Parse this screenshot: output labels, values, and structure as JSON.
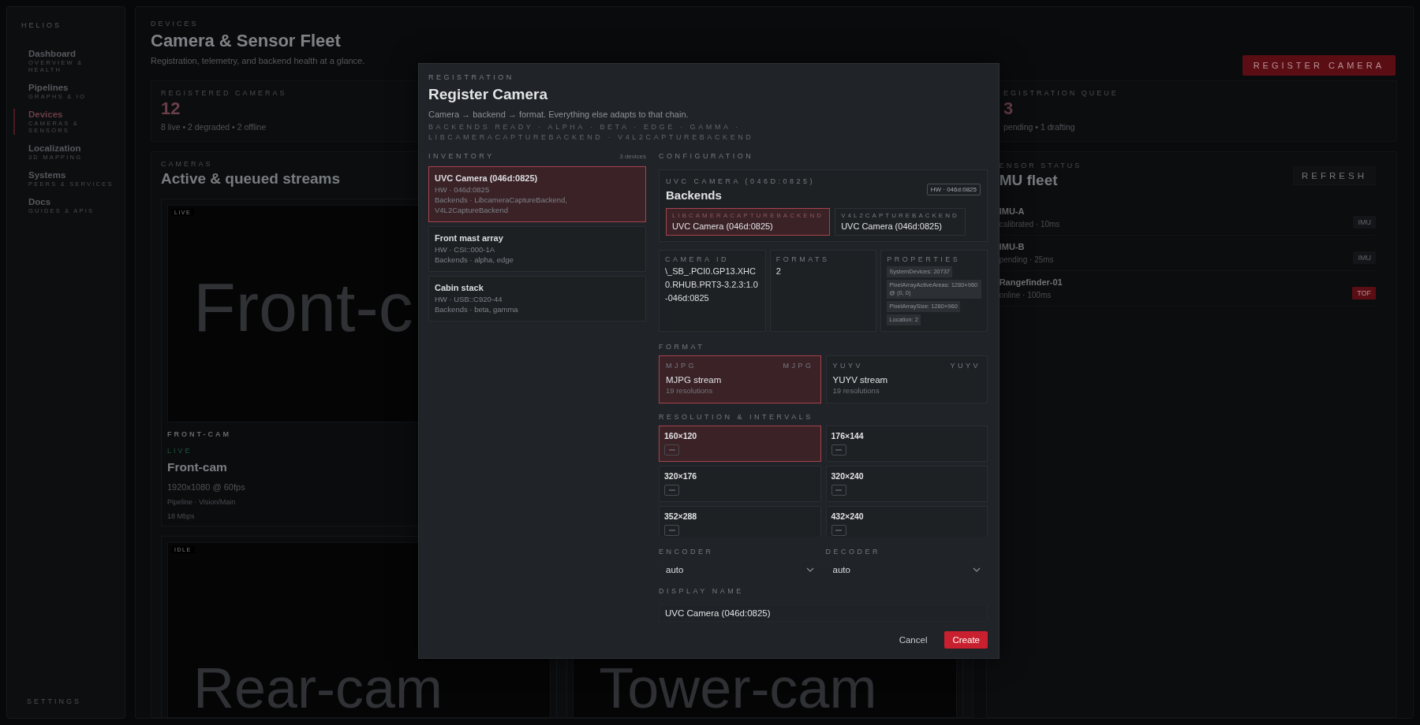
{
  "sidebar": {
    "brand": "HELIOS",
    "items": [
      {
        "label": "Dashboard",
        "sublabel": "OVERVIEW & HEALTH",
        "selected": false
      },
      {
        "label": "Pipelines",
        "sublabel": "GRAPHS & IO",
        "selected": false
      },
      {
        "label": "Devices",
        "sublabel": "CAMERAS & SENSORS",
        "selected": true
      },
      {
        "label": "Localization",
        "sublabel": "3D MAPPING",
        "selected": false
      },
      {
        "label": "Systems",
        "sublabel": "PEERS & SERVICES",
        "selected": false
      },
      {
        "label": "Docs",
        "sublabel": "GUIDES & APIS",
        "selected": false
      }
    ],
    "footer": "SETTINGS"
  },
  "header": {
    "eyebrow": "DEVICES",
    "title": "Camera & Sensor Fleet",
    "subtitle": "Registration, telemetry, and backend health at a glance.",
    "action": "REGISTER CAMERA"
  },
  "stats": [
    {
      "label": "REGISTERED CAMERAS",
      "value": "12",
      "detail": "8 live • 2 degraded • 2 offline"
    },
    {
      "label": "EGISTRATION QUEUE",
      "value": "3",
      "detail": "pending • 1 drafting"
    }
  ],
  "cameras": {
    "eyebrow": "CAMERAS",
    "title": "Active & queued streams",
    "cards": [
      {
        "tag": "LIVE",
        "preview": "Front-c",
        "caps_name": "FRONT-CAM",
        "status": "LIVE",
        "name": "Front-cam",
        "resolution": "1920x1080 @ 60fps",
        "pipeline": "Pipeline · Vision/Main",
        "bitrate": "18 Mbps"
      },
      {
        "tag": "IDLE",
        "preview": "Rear-cam"
      },
      {
        "preview": "Tower-cam"
      }
    ]
  },
  "sensors": {
    "eyebrow": "ENSOR STATUS",
    "title": "MU fleet",
    "action": "REFRESH",
    "items": [
      {
        "name": "IMU-A",
        "detail": "calibrated · 10ms",
        "badge": "IMU",
        "kind": "muted"
      },
      {
        "name": "IMU-B",
        "detail": "pending · 25ms",
        "badge": "IMU",
        "kind": "muted"
      },
      {
        "name": "Rangefinder-01",
        "detail": "online · 100ms",
        "badge": "TOF",
        "kind": "alert"
      }
    ]
  },
  "modal": {
    "eyebrow": "REGISTRATION",
    "title": "Register Camera",
    "description": "Camera → backend → format. Everything else adapts to that chain.",
    "backends_ready": "BACKENDS READY · ALPHA · BETA · EDGE · GAMMA · LIBCAMERACAPTUREBACKEND · V4L2CAPTUREBACKEND",
    "inventory": {
      "label": "INVENTORY",
      "count": "3 devices",
      "items": [
        {
          "name": "UVC Camera (046d:0825)",
          "hw": "HW · 046d:0825",
          "backends": "Backends · LibcameraCaptureBackend, V4L2CaptureBackend",
          "selected": true
        },
        {
          "name": "Front mast array",
          "hw": "HW · CSI::000-1A",
          "backends": "Backends · alpha, edge",
          "selected": false
        },
        {
          "name": "Cabin stack",
          "hw": "HW · USB::C920-44",
          "backends": "Backends · beta, gamma",
          "selected": false
        }
      ]
    },
    "configuration": {
      "label": "CONFIGURATION",
      "camera": {
        "eyebrow": "UVC CAMERA (046D:0825)",
        "title": "Backends",
        "hw_badge": "HW · 046d:0825",
        "backends": [
          {
            "name": "LIBCAMERACAPTUREBACKEND",
            "camera": "UVC Camera (046d:0825)",
            "selected": true
          },
          {
            "name": "V4L2CAPTUREBACKEND",
            "camera": "UVC Camera (046d:0825)",
            "selected": false
          }
        ]
      },
      "details": [
        {
          "kind": "text",
          "label": "CAMERA ID",
          "value": "\\_SB_.PCI0.GP13.XHC0.RHUB.PRT3-3.2.3:1.0-046d:0825"
        },
        {
          "kind": "text",
          "label": "FORMATS",
          "value": "2"
        },
        {
          "kind": "chips",
          "label": "PROPERTIES",
          "chips": [
            "SystemDevices: 20737",
            "PixelArrayActiveAreas: 1280×960 @ (0, 0)",
            "PixelArraySize: 1280×960",
            "Location: 2"
          ]
        }
      ],
      "format": {
        "label": "FORMAT",
        "options": [
          {
            "code": "MJPG",
            "fourcc": "MJPG",
            "name": "MJPG stream",
            "detail": "19 resolutions",
            "selected": true
          },
          {
            "code": "YUYV",
            "fourcc": "YUYV",
            "name": "YUYV stream",
            "detail": "19 resolutions",
            "selected": false
          }
        ]
      },
      "resolutions": {
        "label": "RESOLUTION & INTERVALS",
        "items": [
          {
            "size": "160×120",
            "selected": true
          },
          {
            "size": "176×144",
            "selected": false
          },
          {
            "size": "320×176",
            "selected": false
          },
          {
            "size": "320×240",
            "selected": false
          },
          {
            "size": "352×288",
            "selected": false
          },
          {
            "size": "432×240",
            "selected": false
          }
        ]
      },
      "encoder": {
        "label": "ENCODER",
        "value": "auto"
      },
      "decoder": {
        "label": "DECODER",
        "value": "auto"
      },
      "display_name": {
        "label": "DISPLAY NAME",
        "value": "UVC Camera (046d:0825)"
      }
    },
    "buttons": [
      {
        "label": "Cancel",
        "kind": "secondary"
      },
      {
        "label": "Create",
        "kind": "primary"
      }
    ]
  }
}
